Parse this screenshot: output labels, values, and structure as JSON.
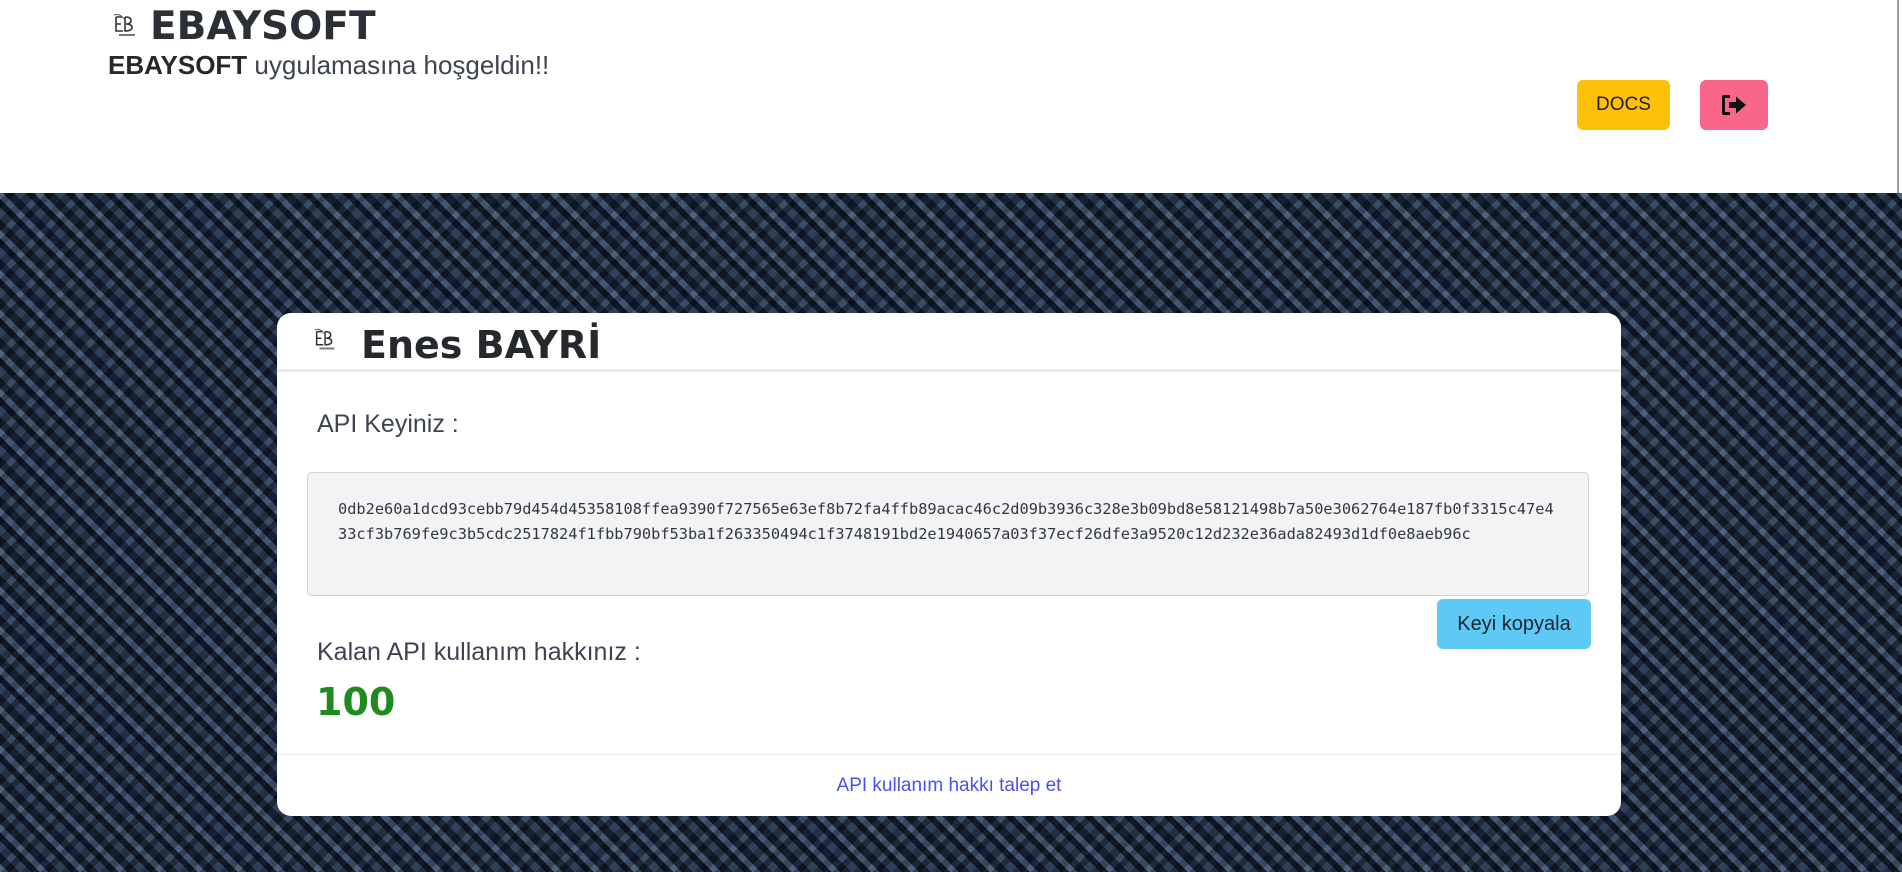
{
  "header": {
    "brand_title": "EBAYSOFT",
    "welcome_brand": "EBAYSOFT",
    "welcome_text": " uygulamasına hoşgeldin!!",
    "docs_label": "DOCS"
  },
  "card": {
    "user_name": "Enes BAYRİ",
    "api_key_label": "API Keyiniz :",
    "api_key": "0db2e60a1dcd93cebb79d454d45358108ffea9390f727565e63ef8b72fa4ffb89acac46c2d09b3936c328e3b09bd8e58121498b7a50e3062764e187fb0f3315c47e433cf3b769fe9c3b5cdc2517824f1fbb790bf53ba1f263350494c1f3748191bd2e1940657a03f37ecf26dfe3a9520c12d232e36ada82493d1df0e8aeb96c",
    "copy_label": "Keyi kopyala",
    "usage_label": "Kalan API kullanım hakkınız :",
    "usage_value": "100",
    "request_link": "API kullanım hakkı talep et"
  },
  "icons": {
    "logo": "ebaysoft-logo-icon",
    "logout": "sign-out-icon"
  },
  "colors": {
    "docs_button": "#ffc107",
    "logout_button": "#f8668a",
    "copy_button": "#5fc9f5",
    "usage_value": "#1f8b1f",
    "link": "#4a4ff0"
  }
}
